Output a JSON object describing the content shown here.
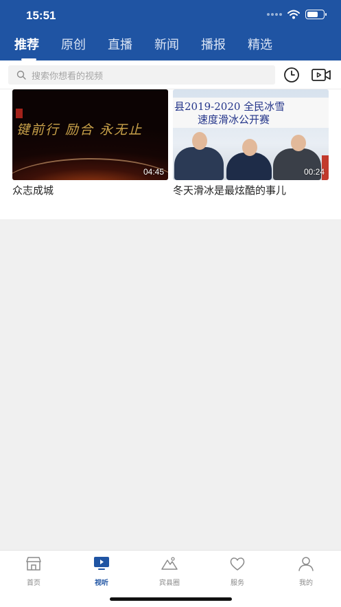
{
  "status_bar": {
    "time": "15:51"
  },
  "tabs": [
    {
      "label": "推荐",
      "active": true
    },
    {
      "label": "原创",
      "active": false
    },
    {
      "label": "直播",
      "active": false
    },
    {
      "label": "新闻",
      "active": false
    },
    {
      "label": "播报",
      "active": false
    },
    {
      "label": "精选",
      "active": false
    }
  ],
  "search": {
    "placeholder": "搜索你想看的视频"
  },
  "videos": [
    {
      "title": "众志成城",
      "duration": "04:45",
      "thumb_text": "键前行  励合  永无止"
    },
    {
      "title": "冬天滑冰是最炫酷的事儿",
      "duration": "00:24",
      "thumb_text_line1": "县2019-2020 全民冰雪",
      "thumb_text_line2": "速度滑冰公开赛"
    }
  ],
  "bottom_nav": [
    {
      "label": "首页",
      "icon": "home-icon",
      "active": false
    },
    {
      "label": "视听",
      "icon": "tv-play-icon",
      "active": true
    },
    {
      "label": "宾县圈",
      "icon": "mountain-icon",
      "active": false
    },
    {
      "label": "服务",
      "icon": "heart-icon",
      "active": false
    },
    {
      "label": "我的",
      "icon": "user-icon",
      "active": false
    }
  ],
  "colors": {
    "brand": "#1f54a3",
    "background": "#f0f0f0"
  }
}
